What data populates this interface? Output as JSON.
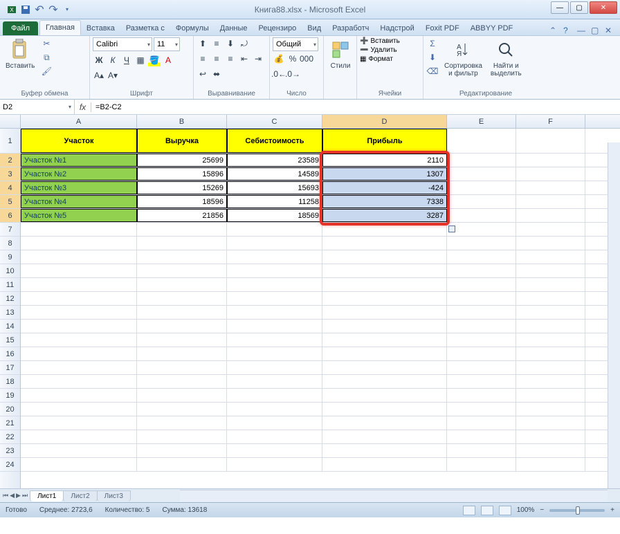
{
  "window": {
    "title": "Книга88.xlsx - Microsoft Excel"
  },
  "tabs": {
    "file": "Файл",
    "items": [
      "Главная",
      "Вставка",
      "Разметка с",
      "Формулы",
      "Данные",
      "Рецензиро",
      "Вид",
      "Разработч",
      "Надстрой",
      "Foxit PDF",
      "ABBYY PDF"
    ],
    "active": 0
  },
  "ribbon": {
    "clipboard": {
      "paste": "Вставить",
      "label": "Буфер обмена"
    },
    "font": {
      "name": "Calibri",
      "size": "11",
      "label": "Шрифт"
    },
    "alignment": {
      "label": "Выравнивание"
    },
    "number": {
      "format": "Общий",
      "label": "Число"
    },
    "styles": {
      "styles": "Стили",
      "label": "Стили"
    },
    "cells": {
      "insert": "Вставить",
      "delete": "Удалить",
      "format": "Формат",
      "label": "Ячейки"
    },
    "editing": {
      "sort": "Сортировка\nи фильтр",
      "find": "Найти и\nвыделить",
      "label": "Редактирование"
    }
  },
  "namebox": "D2",
  "formula": "=B2-C2",
  "columns": [
    "A",
    "B",
    "C",
    "D",
    "E",
    "F"
  ],
  "table": {
    "headers": [
      "Участок",
      "Выручка",
      "Себистоимость",
      "Прибыль"
    ],
    "rows": [
      {
        "name": "Участок №1",
        "rev": 25699,
        "cost": 23589,
        "profit": 2110
      },
      {
        "name": "Участок №2",
        "rev": 15896,
        "cost": 14589,
        "profit": 1307
      },
      {
        "name": "Участок №3",
        "rev": 15269,
        "cost": 15693,
        "profit": -424
      },
      {
        "name": "Участок №4",
        "rev": 18596,
        "cost": 11258,
        "profit": 7338
      },
      {
        "name": "Участок №5",
        "rev": 21856,
        "cost": 18569,
        "profit": 3287
      }
    ]
  },
  "chart_data": {
    "type": "table",
    "columns": [
      "Участок",
      "Выручка",
      "Себистоимость",
      "Прибыль"
    ],
    "rows": [
      [
        "Участок №1",
        25699,
        23589,
        2110
      ],
      [
        "Участок №2",
        15896,
        14589,
        1307
      ],
      [
        "Участок №3",
        15269,
        15693,
        -424
      ],
      [
        "Участок №4",
        18596,
        11258,
        7338
      ],
      [
        "Участок №5",
        21856,
        18569,
        3287
      ]
    ]
  },
  "sheets": [
    "Лист1",
    "Лист2",
    "Лист3"
  ],
  "status": {
    "ready": "Готово",
    "avg_label": "Среднее:",
    "avg": "2723,6",
    "count_label": "Количество:",
    "count": "5",
    "sum_label": "Сумма:",
    "sum": "13618",
    "zoom": "100%"
  }
}
